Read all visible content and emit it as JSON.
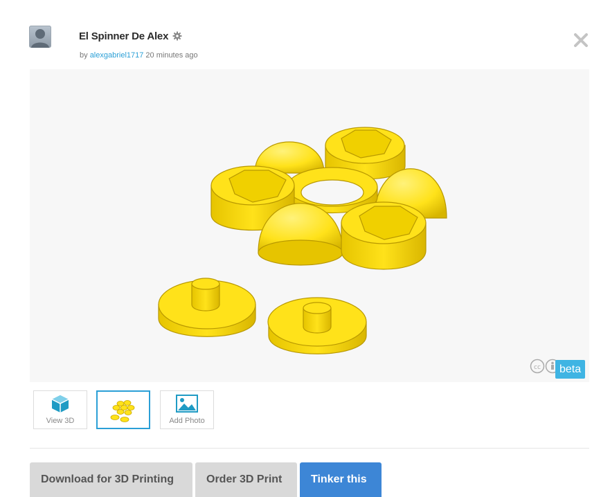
{
  "header": {
    "title": "El Spinner De Alex",
    "by_prefix": "by",
    "author": "alexgabriel1717",
    "time": "20 minutes ago"
  },
  "icons": {
    "avatar": "user-avatar",
    "settings": "gear-icon",
    "close": "close-icon",
    "license_cc": "cc-icon",
    "license_by": "attribution-icon"
  },
  "viewer": {
    "badge": "beta"
  },
  "thumbnails": [
    {
      "label": "View 3D",
      "icon": "cube-icon"
    },
    {
      "label": "",
      "icon": "model-thumbnail",
      "active": true
    },
    {
      "label": "Add Photo",
      "icon": "image-icon"
    }
  ],
  "actions": {
    "download": "Download for 3D Printing",
    "order": "Order 3D Print",
    "tinker": "Tinker this"
  },
  "colors": {
    "accent": "#2a9fd6",
    "primary_button": "#3d86d6",
    "secondary_button": "#d9d9d9",
    "model": "#ffe21a"
  }
}
